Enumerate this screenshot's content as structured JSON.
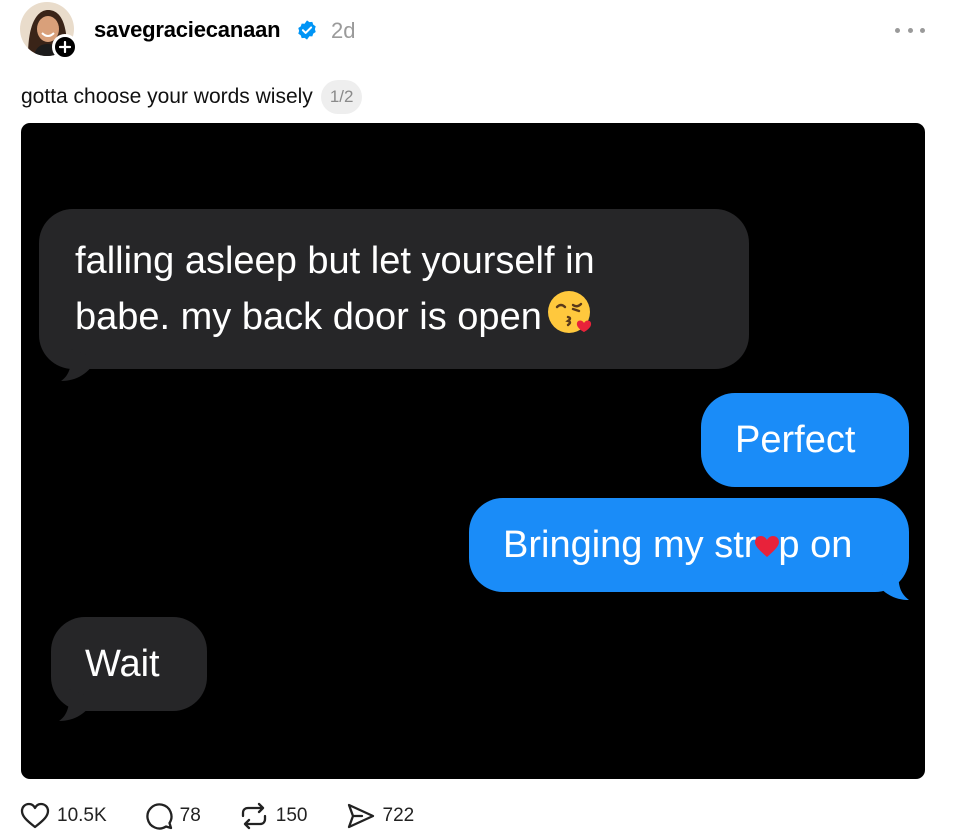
{
  "post": {
    "username": "savegraciecanaan",
    "timestamp": "2d",
    "caption": "gotta choose your words wisely",
    "media_counter": "1/2"
  },
  "messages": [
    {
      "side": "received",
      "text": "falling asleep but let yourself in\nbabe. my back door is open",
      "emoji": "kissing-face-with-heart"
    },
    {
      "side": "sent",
      "text": "Perfect"
    },
    {
      "side": "sent",
      "text_before": "Bringing my str",
      "text_after": "p on",
      "inline_emoji": "red-heart"
    },
    {
      "side": "received",
      "text": "Wait"
    }
  ],
  "actions": {
    "likes": "10.5K",
    "replies": "78",
    "reposts": "150",
    "shares": "722"
  },
  "colors": {
    "sent_bubble": "#1a8cf8",
    "received_bubble": "#262628",
    "verified_badge": "#0095f6",
    "muted_text": "#9a9a9a"
  },
  "icons": [
    "verified-icon",
    "plus-icon",
    "more-icon",
    "heart-icon",
    "comment-icon",
    "repost-icon",
    "share-icon"
  ]
}
